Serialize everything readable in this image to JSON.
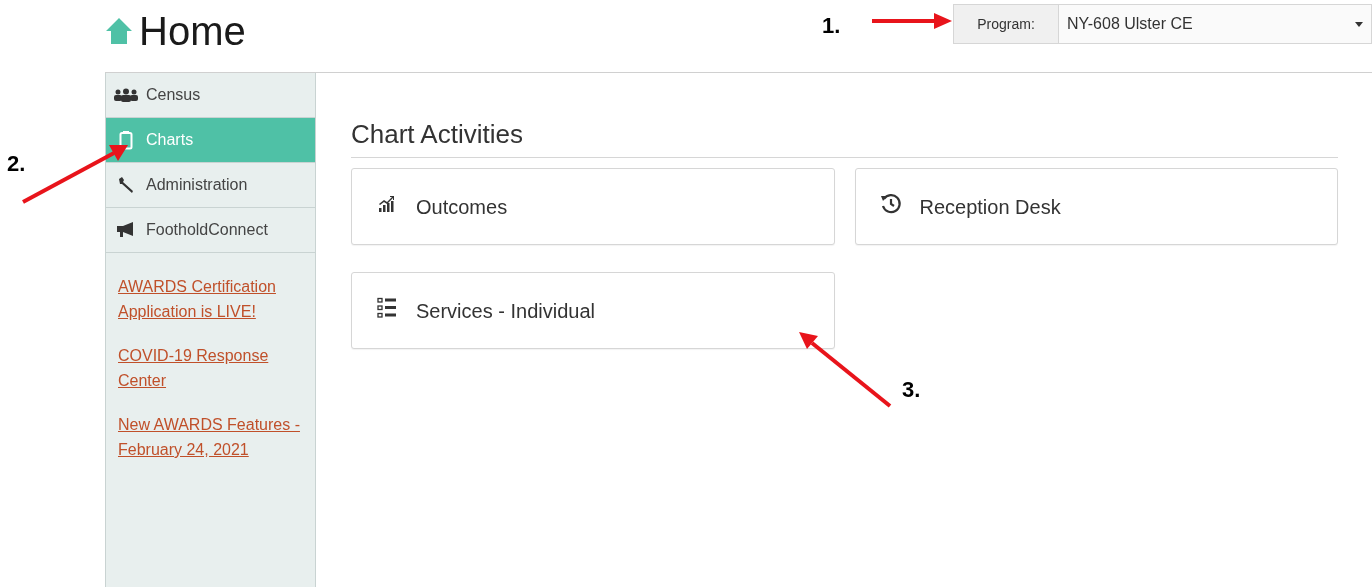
{
  "header": {
    "title": "Home"
  },
  "program_selector": {
    "label": "Program:",
    "value": "NY-608 Ulster CE"
  },
  "sidebar": {
    "items": [
      {
        "label": "Census",
        "selected": false
      },
      {
        "label": "Charts",
        "selected": true
      },
      {
        "label": "Administration",
        "selected": false
      },
      {
        "label": "FootholdConnect",
        "selected": false
      }
    ],
    "links": [
      "AWARDS Certification Application is LIVE!",
      "COVID-19 Response Center",
      "New AWARDS Features - February 24, 2021"
    ]
  },
  "main": {
    "heading": "Chart Activities",
    "tiles": [
      {
        "label": "Outcomes"
      },
      {
        "label": "Reception Desk"
      },
      {
        "label": "Services - Individual"
      }
    ]
  },
  "annotations": [
    {
      "number": "1."
    },
    {
      "number": "2."
    },
    {
      "number": "3."
    }
  ]
}
